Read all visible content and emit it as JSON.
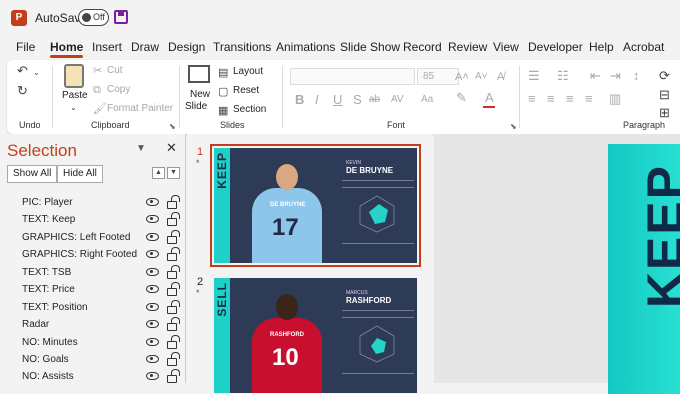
{
  "titlebar": {
    "app_icon": "powerpoint-icon",
    "autosave_label": "AutoSave",
    "autosave_state": "Off",
    "save_icon": "save-icon"
  },
  "tabs": [
    "File",
    "Home",
    "Insert",
    "Draw",
    "Design",
    "Transitions",
    "Animations",
    "Slide Show",
    "Record",
    "Review",
    "View",
    "Developer",
    "Help",
    "Acrobat"
  ],
  "active_tab": "Home",
  "ribbon": {
    "undo_group": "Undo",
    "clipboard": {
      "label": "Clipboard",
      "paste": "Paste",
      "cut": "Cut",
      "copy": "Copy",
      "format_painter": "Format Painter"
    },
    "slides": {
      "label": "Slides",
      "new_slide_line1": "New",
      "new_slide_line2": "Slide",
      "layout": "Layout",
      "reset": "Reset",
      "section": "Section"
    },
    "font": {
      "label": "Font",
      "size": "85",
      "bold": "B",
      "italic": "I",
      "underline": "U",
      "shadow": "S",
      "strike": "ab",
      "spacing": "AV",
      "case": "Aa"
    },
    "paragraph": {
      "label": "Paragraph"
    }
  },
  "selection_pane": {
    "title": "Selection",
    "show_all": "Show All",
    "hide_all": "Hide All",
    "items": [
      "PIC: Player",
      "TEXT: Keep",
      "GRAPHICS: Left Footed",
      "GRAPHICS: Right Footed",
      "TEXT: TSB",
      "TEXT: Price",
      "TEXT: Position",
      "Radar",
      "NO: Minutes",
      "NO: Goals",
      "NO: Assists"
    ]
  },
  "thumbnails": [
    {
      "number": "1",
      "star": "*",
      "side_text": "KEEP",
      "first_name": "KEVIN",
      "player_name": "DE BRUYNE",
      "jersey_name": "DE BRUYNE",
      "jersey_number": "17",
      "band_color": "#1fd0c8",
      "shirt_color": "#8ec5ea"
    },
    {
      "number": "2",
      "star": "*",
      "side_text": "SELL",
      "first_name": "MARCUS",
      "player_name": "RASHFORD",
      "jersey_name": "RASHFORD",
      "jersey_number": "10",
      "band_color": "#1fd0c8",
      "shirt_color": "#c8102e"
    }
  ],
  "canvas": {
    "big_text": "KEEP"
  },
  "colors": {
    "accent": "#c43e1c",
    "slide_bg": "#2d3b57",
    "teal": "#1fd0c8"
  }
}
